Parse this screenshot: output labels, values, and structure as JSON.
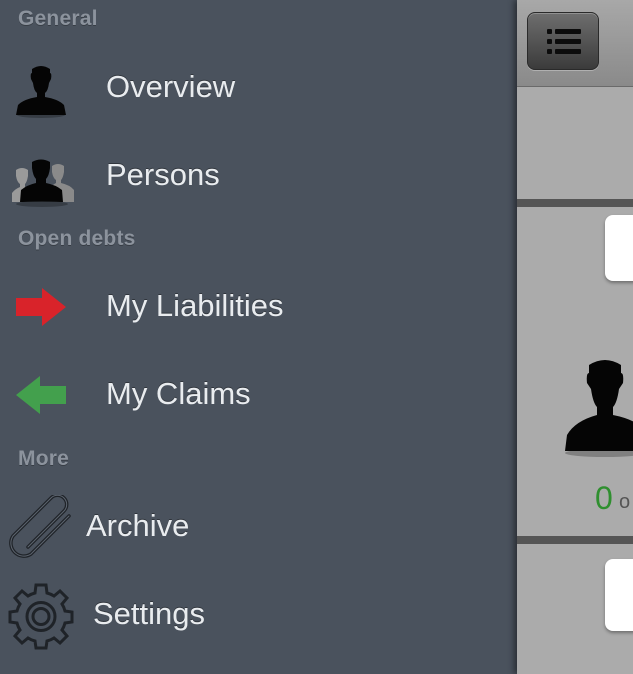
{
  "sidebar": {
    "sections": [
      {
        "header": "General",
        "items": [
          {
            "label": "Overview",
            "icon": "person-icon"
          },
          {
            "label": "Persons",
            "icon": "persons-icon"
          }
        ]
      },
      {
        "header": "Open debts",
        "items": [
          {
            "label": "My Liabilities",
            "icon": "arrow-right-icon"
          },
          {
            "label": "My Claims",
            "icon": "arrow-left-icon"
          }
        ]
      },
      {
        "header": "More",
        "items": [
          {
            "label": "Archive",
            "icon": "paperclip-icon"
          },
          {
            "label": "Settings",
            "icon": "gear-icon"
          }
        ]
      }
    ]
  },
  "main": {
    "menu_button_icon": "list-icon",
    "count": "0",
    "count_suffix": "o"
  },
  "colors": {
    "sidebar_bg": "#4a525d",
    "section_header": "#8c939d",
    "item_text": "#e9ecef",
    "liabilities_arrow": "#d9232a",
    "claims_arrow": "#43a04d",
    "count": "#2f8f2f"
  }
}
